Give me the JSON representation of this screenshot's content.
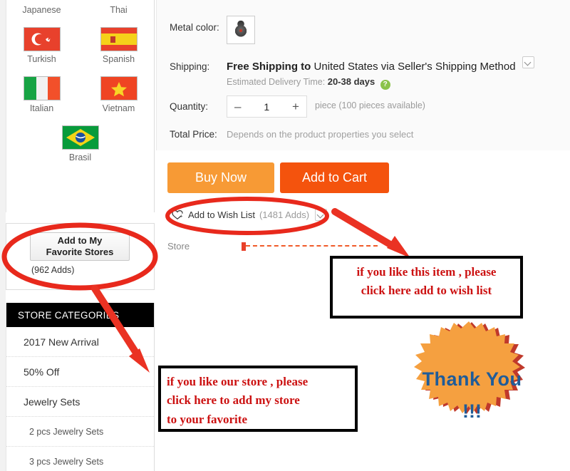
{
  "sidebar": {
    "languages": [
      {
        "label": "Japanese",
        "flag": "japan-flag",
        "label_only": true
      },
      {
        "label": "Thai",
        "flag": "thai-flag",
        "label_only": true
      },
      {
        "label": "Turkish",
        "flag": "turkish-flag"
      },
      {
        "label": "Spanish",
        "flag": "spanish-flag"
      },
      {
        "label": "Italian",
        "flag": "italian-flag"
      },
      {
        "label": "Vietnam",
        "flag": "vietnam-flag"
      },
      {
        "label": "Brasil",
        "flag": "brasil-flag"
      }
    ],
    "favorite": {
      "button_label_line1": "Add to My",
      "button_label_line2": "Favorite Stores",
      "adds": "(962 Adds)"
    },
    "categories": {
      "title": "STORE CATEGORIES",
      "items": [
        {
          "label": "2017 New Arrival",
          "sub": false
        },
        {
          "label": "50% Off",
          "sub": false
        },
        {
          "label": "Jewelry Sets",
          "sub": false
        },
        {
          "label": "2 pcs Jewelry Sets",
          "sub": true
        },
        {
          "label": "3 pcs Jewelry Sets",
          "sub": true
        }
      ]
    }
  },
  "product": {
    "metal_color_label": "Metal color:",
    "shipping_label": "Shipping:",
    "shipping_free": "Free Shipping to",
    "shipping_rest": "United States via Seller's Shipping Method",
    "delivery_prefix": "Estimated Delivery Time:",
    "delivery_value": "20-38 days",
    "help_glyph": "?",
    "quantity_label": "Quantity:",
    "quantity_minus": "–",
    "quantity_value": "1",
    "quantity_plus": "+",
    "quantity_note": "piece (100 pieces available)",
    "total_price_label": "Total Price:",
    "total_price_value": "Depends on the product properties you select",
    "buy_now": "Buy Now",
    "add_to_cart": "Add to Cart",
    "wish_label": "Add to Wish List",
    "wish_adds": "(1481 Adds)",
    "store_label": "Store"
  },
  "annotations": {
    "wish_note_line1": "if  you like this item , please",
    "wish_note_line2": "click here add to wish list",
    "store_note_line1": "if  you like our store , please",
    "store_note_line2": "click here to add my store",
    "store_note_line3": "to your favorite",
    "thanks_line1": "Thank You",
    "thanks_line2": "!!!"
  },
  "colors": {
    "buy_now": "#f79a35",
    "add_to_cart": "#f4530d",
    "annotation_red": "#cc1111",
    "highlight_red": "#e8291c",
    "starburst_fill": "#f5a040",
    "starburst_edge": "#c0392b",
    "thanks_text": "#1f5c99",
    "category_header_bg": "#000000"
  }
}
